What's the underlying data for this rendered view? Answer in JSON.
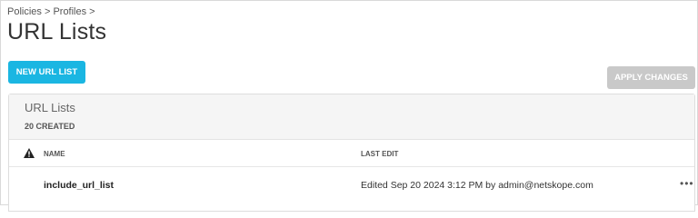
{
  "breadcrumb": "Policies > Profiles >",
  "page_title": "URL Lists",
  "actions": {
    "new_label": "NEW URL LIST",
    "apply_label": "APPLY CHANGES"
  },
  "panel": {
    "title": "URL Lists",
    "count": "20 CREATED",
    "columns": {
      "name": "NAME",
      "last_edit": "LAST EDIT"
    },
    "rows": [
      {
        "name": "include_url_list",
        "last_edit": "Edited Sep 20 2024 3:12 PM by admin@netskope.com",
        "more_icon": "more-horizontal-icon"
      }
    ]
  },
  "colors": {
    "primary": "#1ab6e2",
    "disabled": "#c9c9c9",
    "header_bg": "#f5f5f5"
  }
}
